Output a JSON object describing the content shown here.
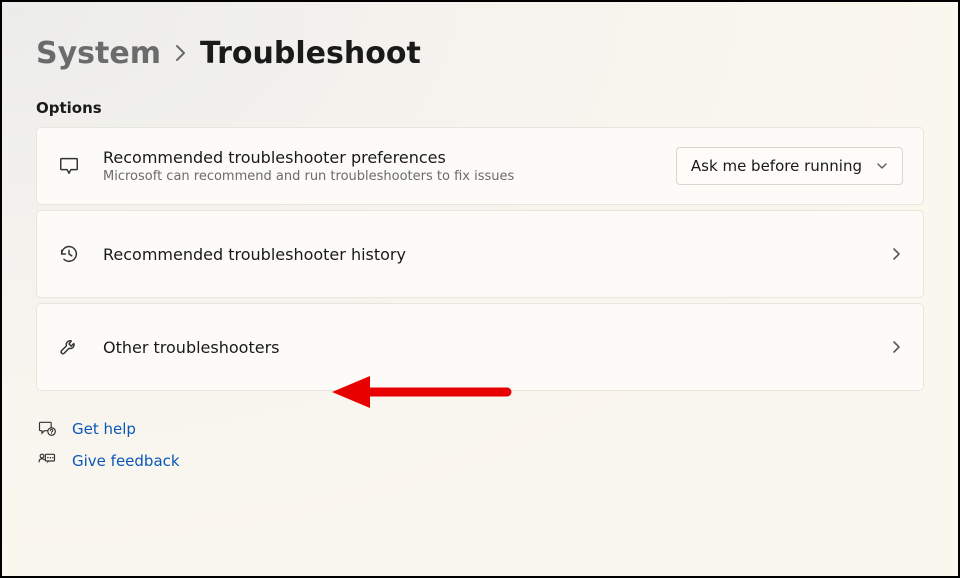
{
  "breadcrumb": {
    "parent": "System",
    "current": "Troubleshoot"
  },
  "section_label": "Options",
  "cards": {
    "prefs": {
      "title": "Recommended troubleshooter preferences",
      "subtitle": "Microsoft can recommend and run troubleshooters to fix issues",
      "dropdown_value": "Ask me before running"
    },
    "history": {
      "title": "Recommended troubleshooter history"
    },
    "other": {
      "title": "Other troubleshooters"
    }
  },
  "links": {
    "help": "Get help",
    "feedback": "Give feedback"
  }
}
